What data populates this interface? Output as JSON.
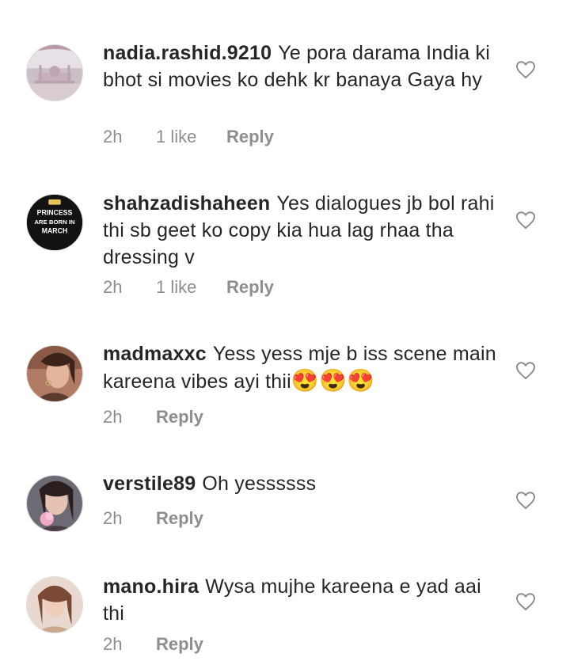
{
  "comments": [
    {
      "username": "nadia.rashid.9210",
      "text": "Ye pora darama India ki bhot si movies ko dehk kr banaya Gaya hy",
      "time": "2h",
      "likes": "1 like",
      "reply": "Reply",
      "avatar": "mosque-photo"
    },
    {
      "username": "shahzadishaheen",
      "text": "Yes dialogues jb bol rahi thi sb geet ko copy kia hua lag rhaa tha dressing v",
      "time": "2h",
      "likes": "1 like",
      "reply": "Reply",
      "avatar": "princess-text-badge",
      "avatar_text": [
        "PRINCESS",
        "ARE BORN IN",
        "MARCH"
      ]
    },
    {
      "username": "madmaxxc",
      "text": "Yess yess mje b iss scene main kareena vibes ayi thii",
      "emojis": "😍😍😍",
      "time": "2h",
      "reply": "Reply",
      "avatar": "woman-portrait"
    },
    {
      "username": "verstile89",
      "text": "Oh yessssss",
      "time": "2h",
      "reply": "Reply",
      "avatar": "woman-with-flower"
    },
    {
      "username": "mano.hira",
      "text": "Wysa mujhe kareena e yad aai thi",
      "time": "2h",
      "reply": "Reply",
      "avatar": "woman-portrait"
    }
  ],
  "icons": {
    "like": "heart-outline-icon"
  },
  "colors": {
    "text": "#262626",
    "meta": "#8e8e8e",
    "heart": "#8e8e8e"
  }
}
